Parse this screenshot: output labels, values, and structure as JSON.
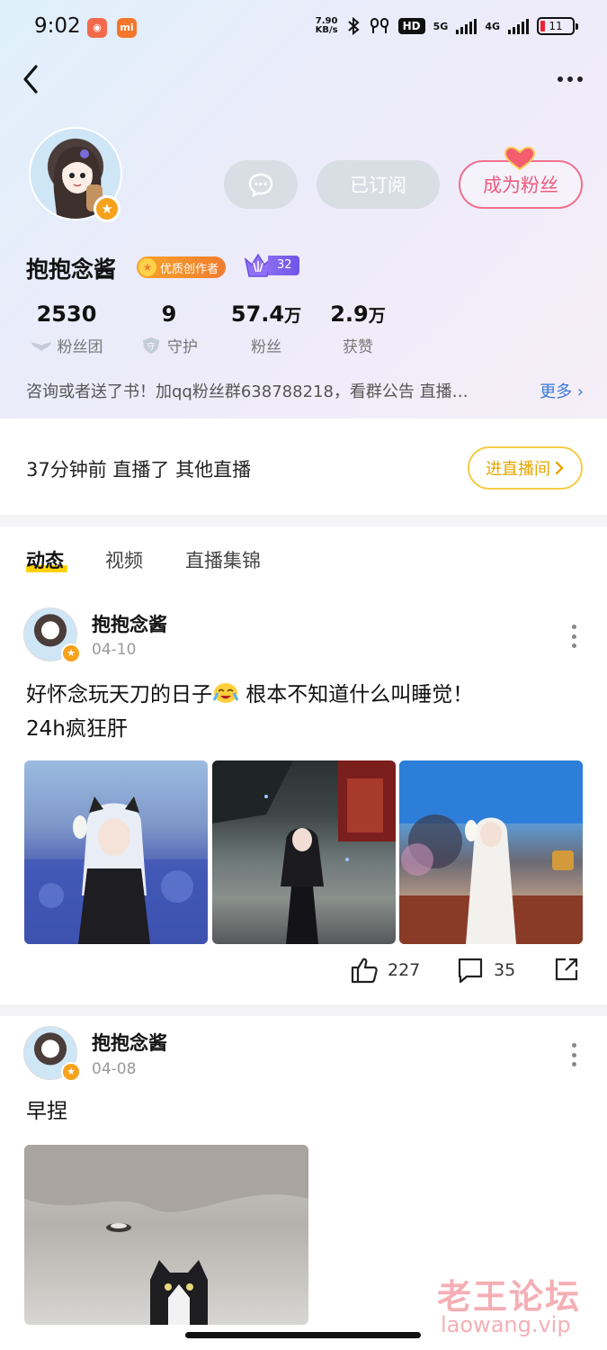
{
  "status_bar": {
    "time": "9:02",
    "app1": "◉",
    "app2": "mi",
    "net_speed_value": "7.90",
    "net_speed_unit": "KB/s",
    "hd": "HD",
    "net5g": "5G",
    "net4g": "4G",
    "battery": "11"
  },
  "header": {
    "chat_icon": "chat-bubble-icon",
    "subscribed_label": "已订阅",
    "become_fan_label": "成为粉丝"
  },
  "profile": {
    "name": "抱抱念酱",
    "creator_badge": "优质创作者",
    "level": "32",
    "stats": [
      {
        "value": "2530",
        "unit": "",
        "label": "粉丝团"
      },
      {
        "value": "9",
        "unit": "",
        "label": "守护"
      },
      {
        "value": "57.4",
        "unit": "万",
        "label": "粉丝"
      },
      {
        "value": "2.9",
        "unit": "万",
        "label": "获赞"
      }
    ],
    "bio": "咨询或者送了书！加qq粉丝群638788218，看群公告  直播…",
    "bio_more": "更多"
  },
  "live": {
    "status": "37分钟前 直播了 其他直播",
    "enter_button": "进直播间"
  },
  "tabs": [
    "动态",
    "视频",
    "直播集锦"
  ],
  "posts": [
    {
      "author": "抱抱念酱",
      "date": "04-10",
      "text_part1": "好怀念玩天刀的日子",
      "text_part2": " 根本不知道什么叫睡觉！",
      "text_line2": "24h疯狂肝",
      "likes": "227",
      "comments": "35"
    },
    {
      "author": "抱抱念酱",
      "date": "04-08",
      "text": "早捏"
    }
  ],
  "watermark": {
    "cn": "老王论坛",
    "en": "laowang.vip"
  }
}
